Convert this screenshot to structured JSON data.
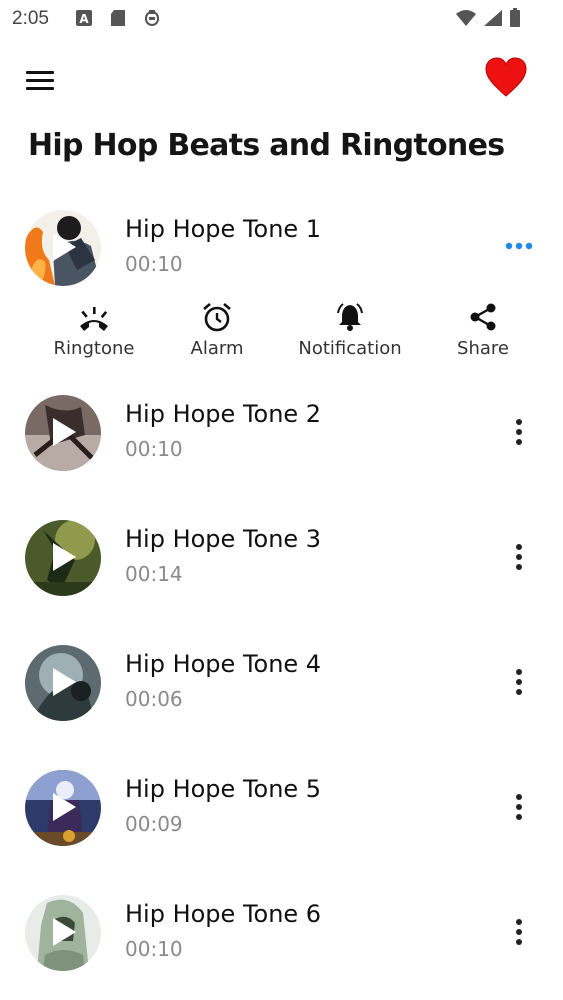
{
  "status_bar": {
    "time": "2:05"
  },
  "header": {
    "title": "Hip Hop Beats and Ringtones",
    "heart_color": "#ee1111"
  },
  "expanded_actions": [
    {
      "label": "Ringtone",
      "icon": "phone-ring-icon"
    },
    {
      "label": "Alarm",
      "icon": "alarm-clock-icon"
    },
    {
      "label": "Notification",
      "icon": "bell-icon"
    },
    {
      "label": "Share",
      "icon": "share-icon"
    }
  ],
  "tones": [
    {
      "title": "Hip Hope Tone 1",
      "duration": "00:10"
    },
    {
      "title": "Hip Hope Tone 2",
      "duration": "00:10"
    },
    {
      "title": "Hip Hope Tone 3",
      "duration": "00:14"
    },
    {
      "title": "Hip Hope Tone 4",
      "duration": "00:06"
    },
    {
      "title": "Hip Hope Tone 5",
      "duration": "00:09"
    },
    {
      "title": "Hip Hope Tone 6",
      "duration": "00:10"
    }
  ],
  "colors": {
    "accent_more": "#1e88e5",
    "text_primary": "#111111",
    "text_secondary": "#8a8a8a"
  }
}
